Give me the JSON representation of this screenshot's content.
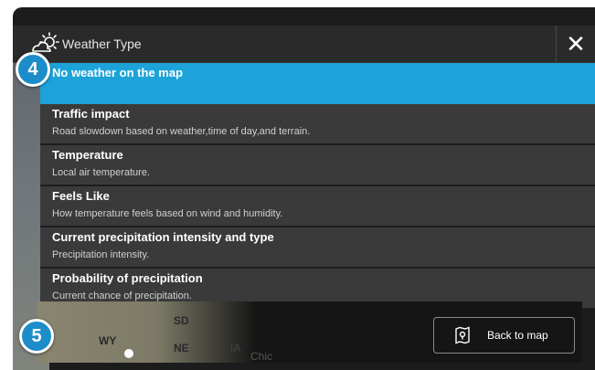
{
  "header": {
    "title": "Weather Type",
    "weather_icon": "partly-sunny-icon",
    "close_icon": "close-icon"
  },
  "weather_types": [
    {
      "title": "No weather on the map",
      "description": "",
      "selected": true
    },
    {
      "title": "Traffic impact",
      "description": "Road slowdown based on weather,time of day,and terrain."
    },
    {
      "title": "Temperature",
      "description": "Local air temperature."
    },
    {
      "title": "Feels Like",
      "description": "How temperature feels based on wind and humidity."
    },
    {
      "title": "Current precipitation intensity and type",
      "description": "Precipitation intensity."
    },
    {
      "title": "Probability of precipitation",
      "description": "Current chance of precipitation."
    }
  ],
  "map_preview": {
    "labels": [
      "SD",
      "WY",
      "NE",
      "IA",
      "Chic"
    ]
  },
  "footer": {
    "back_label": "Back to map",
    "back_icon": "map-pin-icon"
  },
  "callouts": [
    "4",
    "5"
  ],
  "colors": {
    "accent": "#1da3d9",
    "callout": "#1d8dc9",
    "item_bg": "#3a3a3a",
    "header_bg": "#2a2a2a"
  }
}
